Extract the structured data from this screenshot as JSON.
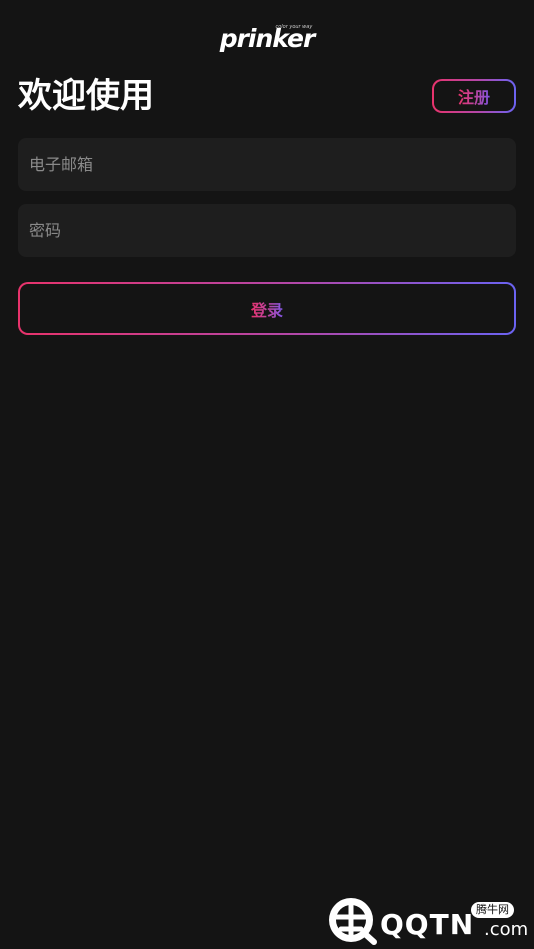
{
  "app": {
    "logo_text": "prinker",
    "logo_tagline": "color your way"
  },
  "header": {
    "welcome_title": "欢迎使用",
    "register_label": "注册"
  },
  "form": {
    "email_placeholder": "电子邮箱",
    "email_value": "",
    "password_placeholder": "密码",
    "password_value": "",
    "login_label": "登录"
  },
  "watermark": {
    "brand": "QQTN",
    "domain_suffix": ".com",
    "badge": "腾牛网"
  },
  "colors": {
    "background": "#141414",
    "input_background": "#1e1e1e",
    "gradient_start": "#e8336c",
    "gradient_mid": "#b347a8",
    "gradient_end": "#6b63f2",
    "placeholder": "#8a8a8a"
  }
}
